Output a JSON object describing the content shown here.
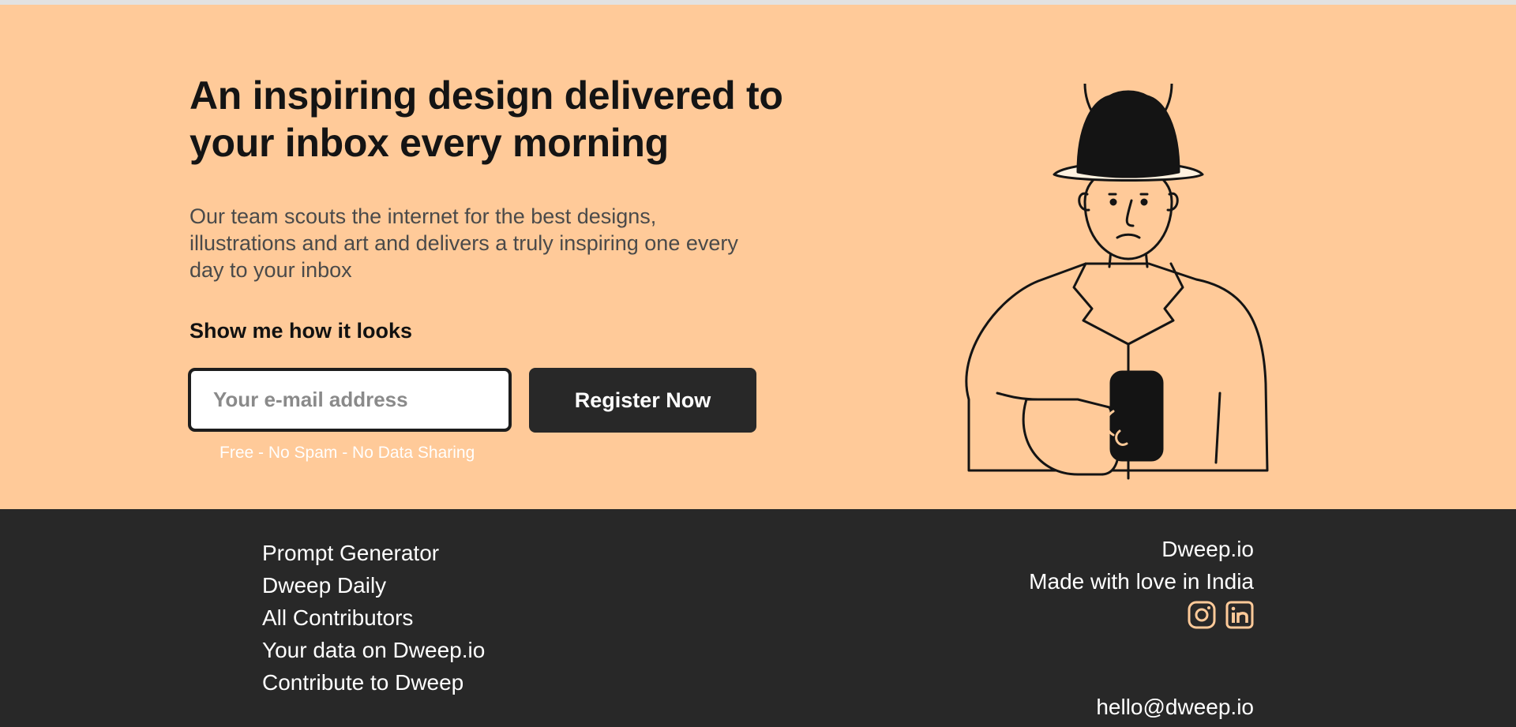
{
  "hero": {
    "headline": "An inspiring design delivered to your inbox every morning",
    "subtext": "Our team scouts the internet for the best designs, illustrations and art and delivers a truly inspiring one every day to your inbox",
    "show_label": "Show me how it looks",
    "email_placeholder": "Your e-mail address",
    "email_value": "",
    "register_label": "Register Now",
    "note": "Free - No Spam - No Data Sharing",
    "illustration_icon": "man-with-hat-holding-phone-illustration"
  },
  "footer": {
    "links": [
      "Prompt Generator",
      "Dweep Daily",
      "All Contributors",
      "Your data on Dweep.io",
      "Contribute to Dweep"
    ],
    "brand": "Dweep.io",
    "made_with": "Made with love in India",
    "socials": [
      "instagram-icon",
      "linkedin-icon"
    ],
    "email": "hello@dweep.io"
  },
  "colors": {
    "hero_bg": "#ffca99",
    "footer_bg": "#282828",
    "button_bg": "#282828",
    "icon_accent": "#ffca99"
  }
}
